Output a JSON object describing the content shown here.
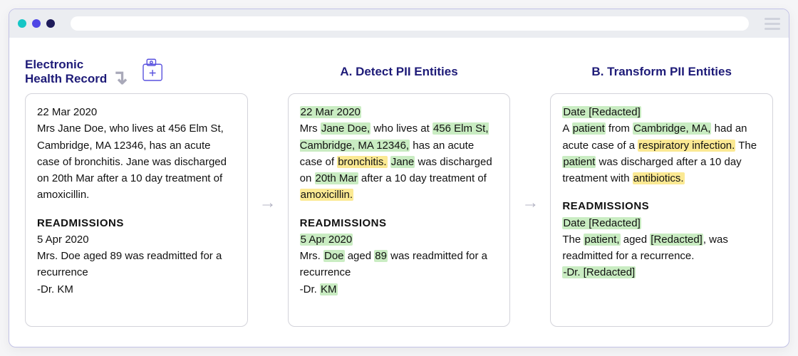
{
  "panels": {
    "ehr": {
      "title": "Electronic\nHealth Record",
      "date1": "22 Mar 2020",
      "body1": "Mrs Jane Doe, who lives at 456 Elm St, Cambridge, MA 12346, has an acute case of bronchitis. Jane was discharged on 20th Mar after a 10 day treatment of amoxicillin.",
      "readmissions_label": "READMISSIONS",
      "date2": "5 Apr 2020",
      "body2": "Mrs. Doe aged 89 was readmitted for a recurrence",
      "sign": "-Dr. KM"
    },
    "detect": {
      "title": "A. Detect PII Entities",
      "date1": "22 Mar 2020",
      "p1_pre": "Mrs ",
      "p1_name": "Jane Doe,",
      "p1_mid1": " who lives at ",
      "p1_addr": "456 Elm St, Cambridge, MA 12346,",
      "p1_mid2": " has an acute case of ",
      "p1_cond": "bronchitis.",
      "p1_mid3": " ",
      "p1_name2": "Jane",
      "p1_mid4": " was discharged on ",
      "p1_date": "20th Mar",
      "p1_mid5": " after a 10 day treatment of ",
      "p1_drug": "amoxicillin.",
      "readmissions_label": "READMISSIONS",
      "date2": "5 Apr 2020",
      "p2_pre": "Mrs. ",
      "p2_name": "Doe",
      "p2_mid1": " aged ",
      "p2_age": "89",
      "p2_mid2": " was readmitted for a recurrence",
      "sign_pre": "-Dr. ",
      "sign_name": "KM"
    },
    "transform": {
      "title": "B. Transform PII Entities",
      "date1": "Date [Redacted]",
      "t1_pre": "A ",
      "t1_patient1": "patient",
      "t1_mid1": " from ",
      "t1_loc": "Cambridge, MA,",
      "t1_mid2": " had an acute case of a ",
      "t1_cond": "respiratory infection.",
      "t1_mid3": " The ",
      "t1_patient2": "patient",
      "t1_mid4": " was discharged after a 10 day treatment with ",
      "t1_drug": "antibiotics.",
      "readmissions_label": "READMISSIONS",
      "date2": "Date [Redacted]",
      "t2_pre": "The ",
      "t2_patient": "patient,",
      "t2_mid1": " aged ",
      "t2_age": "[Redacted]",
      "t2_mid2": ", was readmitted for a recurrence.",
      "sign": "-Dr. [Redacted]"
    }
  }
}
